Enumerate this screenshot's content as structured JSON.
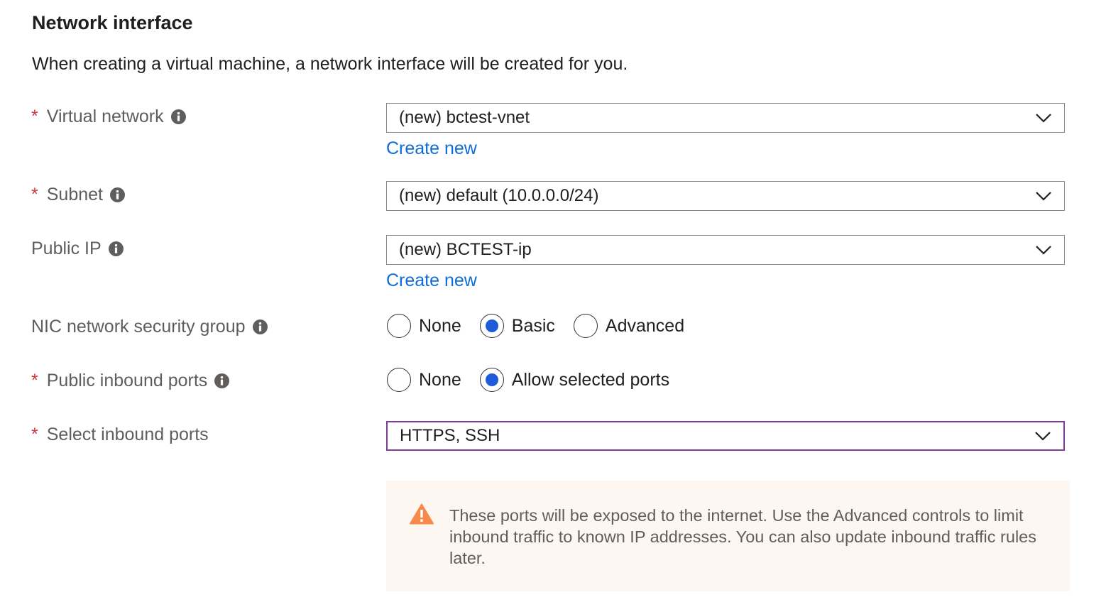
{
  "section": {
    "title": "Network interface",
    "description": "When creating a virtual machine, a network interface will be created for you."
  },
  "fields": {
    "virtual_network": {
      "required": "*",
      "label": "Virtual network",
      "value": "(new) bctest-vnet",
      "create_link": "Create new"
    },
    "subnet": {
      "required": "*",
      "label": "Subnet",
      "value": "(new) default (10.0.0.0/24)"
    },
    "public_ip": {
      "label": "Public IP",
      "value": "(new) BCTEST-ip",
      "create_link": "Create new"
    },
    "nic_nsg": {
      "label": "NIC network security group",
      "options": [
        "None",
        "Basic",
        "Advanced"
      ],
      "selected": "Basic"
    },
    "public_inbound_ports": {
      "required": "*",
      "label": "Public inbound ports",
      "options": [
        "None",
        "Allow selected ports"
      ],
      "selected": "Allow selected ports"
    },
    "select_inbound_ports": {
      "required": "*",
      "label": "Select inbound ports",
      "value": "HTTPS, SSH"
    }
  },
  "warning": {
    "text": "These ports will be exposed to the internet. Use the Advanced controls to limit inbound traffic to known IP addresses. You can also update inbound traffic rules later."
  },
  "colors": {
    "required": "#d13438",
    "link": "#0f6cd6",
    "radio_selected": "#1f5bd8",
    "focused_border": "#7f3f98",
    "warning_bg": "#fdf6f1",
    "warning_icon": "#f7894a"
  },
  "icons": {
    "info": "info-icon",
    "chevron": "chevron-down-icon",
    "warning": "warning-icon"
  }
}
